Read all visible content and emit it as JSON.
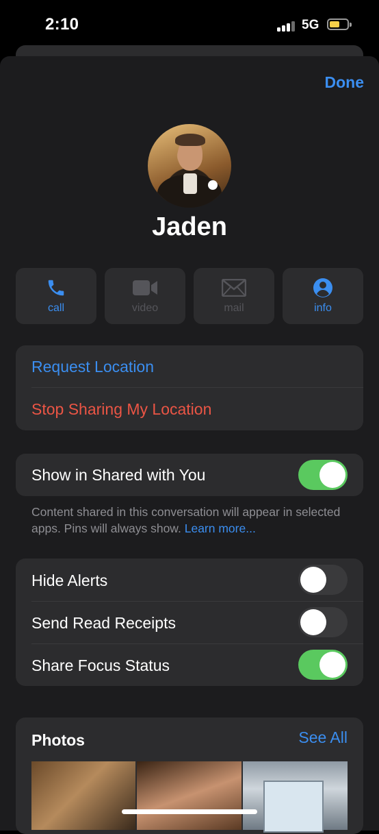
{
  "status_bar": {
    "time": "2:10",
    "network": "5G",
    "battery_level": 0.6,
    "battery_color": "#f6d049"
  },
  "header": {
    "done_label": "Done"
  },
  "contact": {
    "name": "Jaden"
  },
  "actions": [
    {
      "label": "call",
      "icon": "phone-icon",
      "enabled": true
    },
    {
      "label": "video",
      "icon": "video-camera-icon",
      "enabled": false
    },
    {
      "label": "mail",
      "icon": "mail-envelope-icon",
      "enabled": false
    },
    {
      "label": "info",
      "icon": "person-circle-icon",
      "enabled": true
    }
  ],
  "location": {
    "request": "Request Location",
    "stop_sharing": "Stop Sharing My Location"
  },
  "shared_with_you": {
    "label": "Show in Shared with You",
    "enabled": true,
    "footnote": "Content shared in this conversation will appear in selected apps. Pins will always show.",
    "learn_more": "Learn more..."
  },
  "settings": [
    {
      "label": "Hide Alerts",
      "enabled": false
    },
    {
      "label": "Send Read Receipts",
      "enabled": false
    },
    {
      "label": "Share Focus Status",
      "enabled": true
    }
  ],
  "photos": {
    "title": "Photos",
    "see_all": "See All"
  },
  "colors": {
    "accent_blue": "#3b8ef0",
    "destructive_red": "#eb5545",
    "toggle_green": "#5ac95f",
    "sheet_background": "#1c1c1e",
    "card_background": "#2c2c2e"
  }
}
